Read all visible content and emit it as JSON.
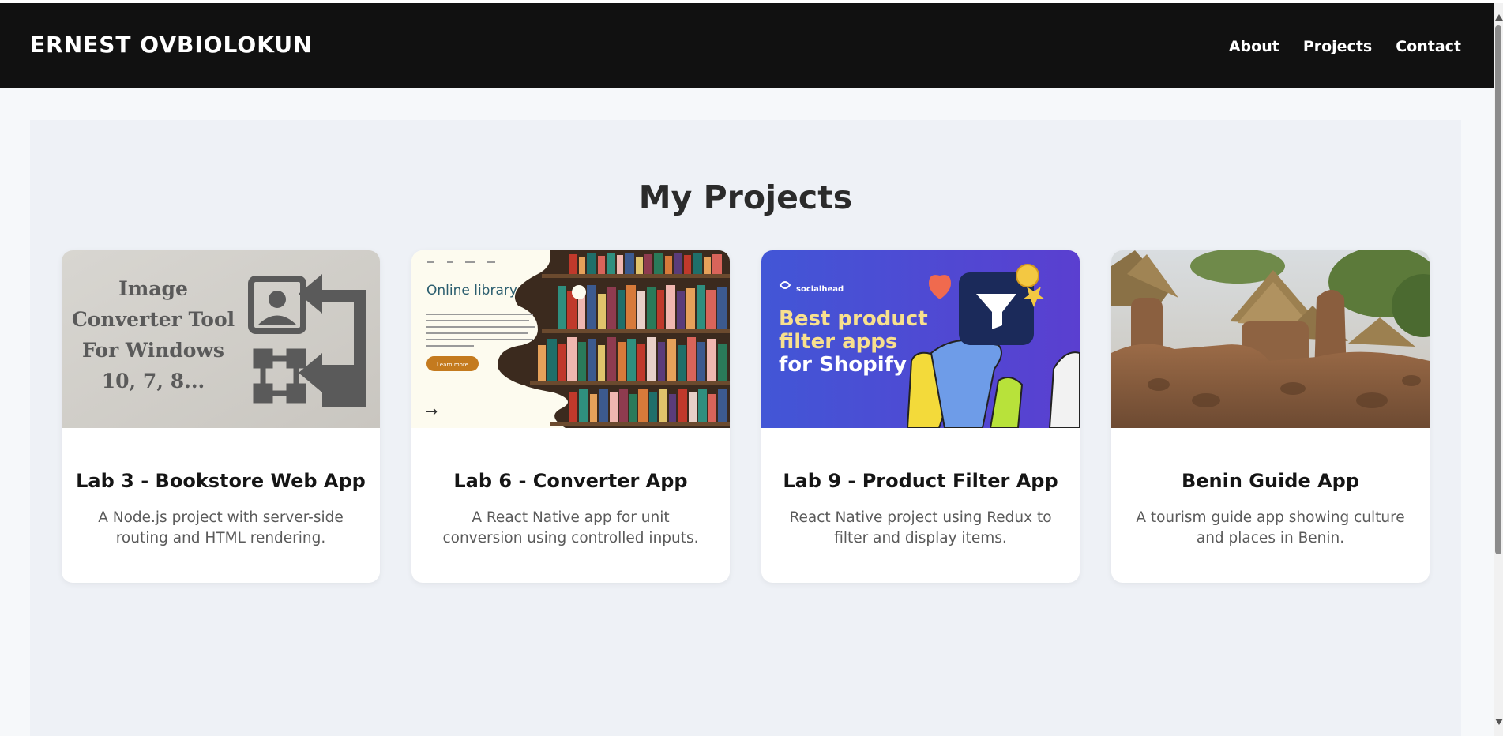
{
  "header": {
    "brand": "ERNEST OVBIOLOKUN",
    "nav": [
      "About",
      "Projects",
      "Contact"
    ]
  },
  "projects_section": {
    "title": "My Projects",
    "cards": [
      {
        "title": "Lab 3 - Bookstore Web App",
        "description": "A Node.js project with server-side routing and HTML rendering.",
        "image_text": [
          "Image",
          "Converter Tool",
          "For Windows",
          "10, 7, 8..."
        ]
      },
      {
        "title": "Lab 6 - Converter App",
        "description": "A React Native app for unit conversion using controlled inputs.",
        "image_text": {
          "heading": "Online library",
          "button": "Learn more"
        }
      },
      {
        "title": "Lab 9 - Product Filter App",
        "description": "React Native project using Redux to filter and display items.",
        "image_text": {
          "logo": "socialhead",
          "line1": "Best product",
          "line2": "filter apps",
          "line3": "for Shopify"
        }
      },
      {
        "title": "Benin Guide App",
        "description": "A tourism guide app showing culture and places in Benin."
      }
    ]
  },
  "colors": {
    "navbar": "#111111",
    "section_bg": "#eef1f6",
    "card_bg": "#ffffff"
  }
}
